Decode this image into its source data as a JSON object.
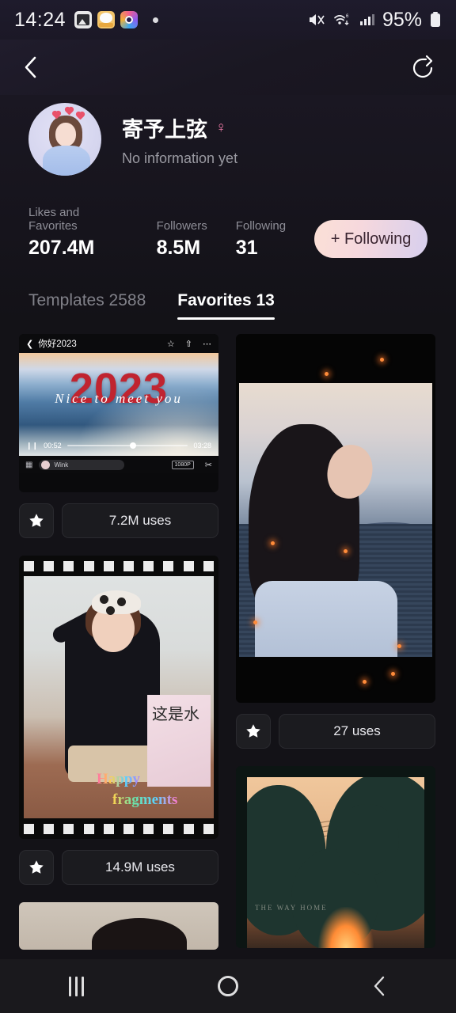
{
  "status_bar": {
    "time": "14:24",
    "battery_percent": "95%",
    "icons": [
      "gallery-icon",
      "cat-app-icon",
      "camera-iris-icon",
      "dot-indicator",
      "mute-icon",
      "wifi-icon",
      "signal-icon",
      "battery-icon"
    ]
  },
  "app_header": {
    "back_icon": "back-chevron-icon",
    "share_icon": "share-icon"
  },
  "profile": {
    "avatar_alt": "user-avatar",
    "username": "寄予上弦",
    "gender_symbol": "♀",
    "bio": "No information yet",
    "stats": [
      {
        "label": "Likes and Favorites",
        "value": "207.4M"
      },
      {
        "label": "Followers",
        "value": "8.5M"
      },
      {
        "label": "Following",
        "value": "31"
      }
    ],
    "follow_button": "+ Following"
  },
  "tabs": [
    {
      "label": "Templates 2588",
      "active": false
    },
    {
      "label": "Favorites 13",
      "active": true
    }
  ],
  "grid": {
    "left_column": [
      {
        "id": "card-2023-video",
        "uses": "7.2M uses",
        "favorited": true,
        "overlay": {
          "title": "你好2023",
          "big_text": "2023",
          "script_text": "Nice to meet you",
          "current_time": "00:52",
          "total_time": "03:28",
          "watermark": "Wink",
          "resolution": "1080P"
        }
      },
      {
        "id": "card-happy-fragments",
        "uses": "14.9M uses",
        "favorited": true,
        "overlay": {
          "text_line1": "Happy",
          "text_line2": "fragments",
          "sign_text": "这是水"
        }
      },
      {
        "id": "card-partial-bottom",
        "uses": "",
        "favorited": false
      }
    ],
    "right_column": [
      {
        "id": "card-seaside-portrait",
        "uses": "27 uses",
        "favorited": true
      },
      {
        "id": "card-sunset-trees",
        "uses": "",
        "favorited": false,
        "overlay": {
          "caption": "THE WAY HOME"
        }
      }
    ]
  },
  "nav_bar": {
    "recents_label": "recents",
    "home_label": "home",
    "back_label": "back"
  },
  "colors": {
    "background": "#131217",
    "header_gradient_start": "#201c2c",
    "follow_gradient_start": "#fbe0d6",
    "follow_gradient_end": "#d7cfee",
    "accent_pink": "#f07aa8",
    "text_primary": "#ffffff",
    "text_secondary": "#8e8e97"
  }
}
